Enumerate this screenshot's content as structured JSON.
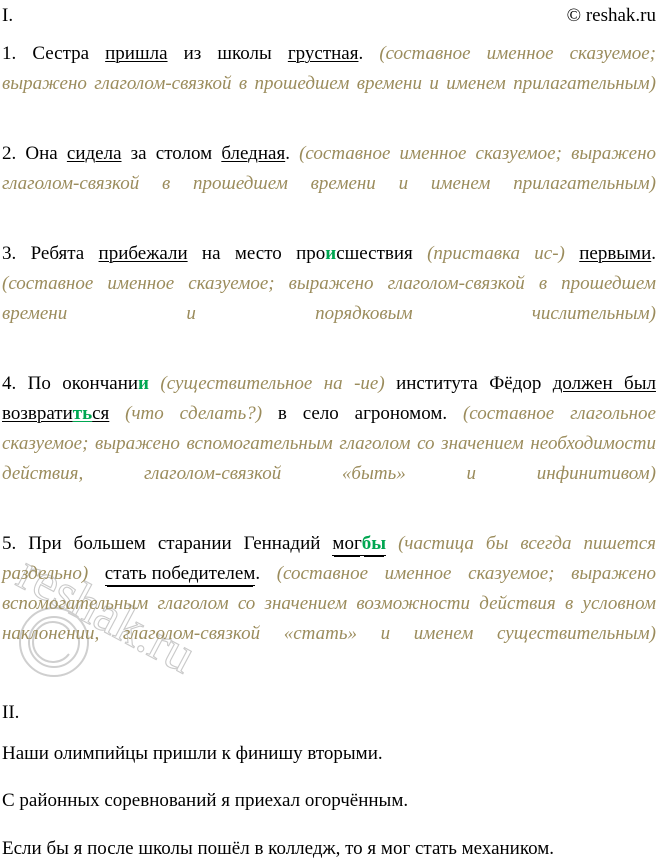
{
  "document": {
    "copyright": "© reshak.ru",
    "section_one_label": "I.",
    "section_two_label": "II."
  },
  "colors": {
    "text": "#000000",
    "comment": "#9b8c5c",
    "highlight_green": "#00a651",
    "watermark": "#c9c9c9",
    "background": "#ffffff"
  },
  "watermark": {
    "text": "reshak.ru",
    "symbol": "©"
  },
  "section_one": {
    "items": [
      {
        "number": "1.",
        "segments": [
          {
            "text": "Сестра ",
            "style": "plain"
          },
          {
            "text": "пришла",
            "style": "underline"
          },
          {
            "text": " из школы ",
            "style": "plain"
          },
          {
            "text": "грустная",
            "style": "underline"
          },
          {
            "text": ". ",
            "style": "plain"
          },
          {
            "text": "(составное именное сказуемое; выражено глаголом-связкой в прошедшем времени и именем прилагательным)",
            "style": "comment"
          }
        ]
      },
      {
        "number": "2.",
        "segments": [
          {
            "text": "Она ",
            "style": "plain"
          },
          {
            "text": "сидела",
            "style": "underline"
          },
          {
            "text": " за столом ",
            "style": "plain"
          },
          {
            "text": "бледная",
            "style": "underline"
          },
          {
            "text": ". ",
            "style": "plain"
          },
          {
            "text": "(составное именное сказуемое; выражено глаголом-связкой в прошедшем времени и именем прилагательным)",
            "style": "comment"
          }
        ]
      },
      {
        "number": "3.",
        "segments": [
          {
            "text": "Ребята ",
            "style": "plain"
          },
          {
            "text": "прибежали",
            "style": "underline"
          },
          {
            "text": " на место про",
            "style": "plain"
          },
          {
            "text": "и",
            "style": "green"
          },
          {
            "text": "сшествия ",
            "style": "plain"
          },
          {
            "text": "(приставка ис-) ",
            "style": "comment"
          },
          {
            "text": "первыми",
            "style": "underline"
          },
          {
            "text": ". ",
            "style": "plain"
          },
          {
            "text": "(составное именное сказуемое; выражено глаголом-связкой в прошедшем времени и порядковым числительным)",
            "style": "comment"
          }
        ]
      },
      {
        "number": "4.",
        "segments": [
          {
            "text": "По окончани",
            "style": "plain"
          },
          {
            "text": "и",
            "style": "green"
          },
          {
            "text": " ",
            "style": "plain"
          },
          {
            "text": "(существительное на -ие) ",
            "style": "comment"
          },
          {
            "text": "института Фёдор ",
            "style": "plain"
          },
          {
            "text": "должен был возврати",
            "style": "underline"
          },
          {
            "text": "ть",
            "style": "green-underline"
          },
          {
            "text": "ся",
            "style": "underline"
          },
          {
            "text": " ",
            "style": "plain"
          },
          {
            "text": "(что сделать?) ",
            "style": "comment"
          },
          {
            "text": "в село агрономом. ",
            "style": "plain"
          },
          {
            "text": "(составное глагольное сказуемое; выражено вспомогательным глаголом со значением необходимости действия, глаголом-связкой «быть» и инфинитивом)",
            "style": "comment"
          }
        ]
      },
      {
        "number": "5.",
        "segments": [
          {
            "text": "При большем старании Геннадий ",
            "style": "plain"
          },
          {
            "text": "мог ",
            "style": "double-underline"
          },
          {
            "text": "бы",
            "style": "green-double-underline"
          },
          {
            "text": " ",
            "style": "plain"
          },
          {
            "text": "(частица бы всегда пишется раздельно) ",
            "style": "comment"
          },
          {
            "text": "стать победителем",
            "style": "double-underline"
          },
          {
            "text": ". ",
            "style": "plain"
          },
          {
            "text": "(составное именное сказуемое; выражено вспомогательным глаголом со значением возможности действия в условном наклонении, глаголом-связкой «стать» и именем существительным)",
            "style": "comment"
          }
        ]
      }
    ]
  },
  "section_two": {
    "sentences": [
      "Наши олимпийцы пришли к финишу вторыми.",
      "С районных соревнований я приехал огорчённым.",
      "Если бы я после школы пошёл в колледж, то я мог стать механиком."
    ]
  }
}
